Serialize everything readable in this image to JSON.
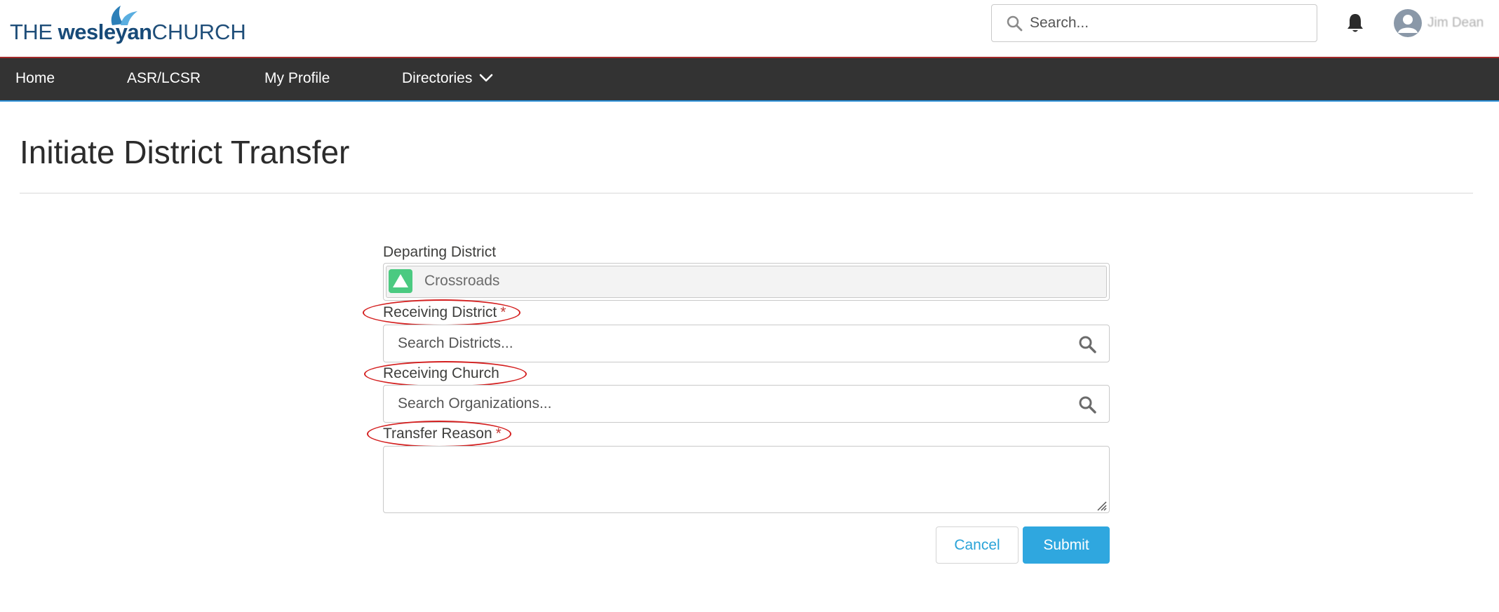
{
  "brand": {
    "logo_the": "THE ",
    "logo_wesleyan": "wesleyan",
    "logo_church": "CHURCH",
    "accent_color": "#2fa7df",
    "nav_bg": "#333333"
  },
  "header": {
    "search_placeholder": "Search...",
    "notification_icon": "bell-icon",
    "user_icon": "user-avatar-icon",
    "user_name": "Jim Dean"
  },
  "nav": {
    "items": [
      {
        "label": "Home"
      },
      {
        "label": "ASR/LCSR"
      },
      {
        "label": "My Profile"
      },
      {
        "label": "Directories",
        "icon": "chevron-down-icon"
      }
    ]
  },
  "page": {
    "title": "Initiate District Transfer"
  },
  "form": {
    "departing_district": {
      "label": "Departing District",
      "value": "Crossroads",
      "icon": "district-icon"
    },
    "receiving_district": {
      "label": "Receiving District",
      "required_mark": "*",
      "placeholder": "Search Districts...",
      "icon": "search-icon"
    },
    "receiving_church": {
      "label": "Receiving Church",
      "placeholder": "Search Organizations...",
      "icon": "search-icon"
    },
    "transfer_reason": {
      "label": "Transfer Reason",
      "required_mark": "*",
      "value": ""
    },
    "cancel_label": "Cancel",
    "submit_label": "Submit"
  }
}
